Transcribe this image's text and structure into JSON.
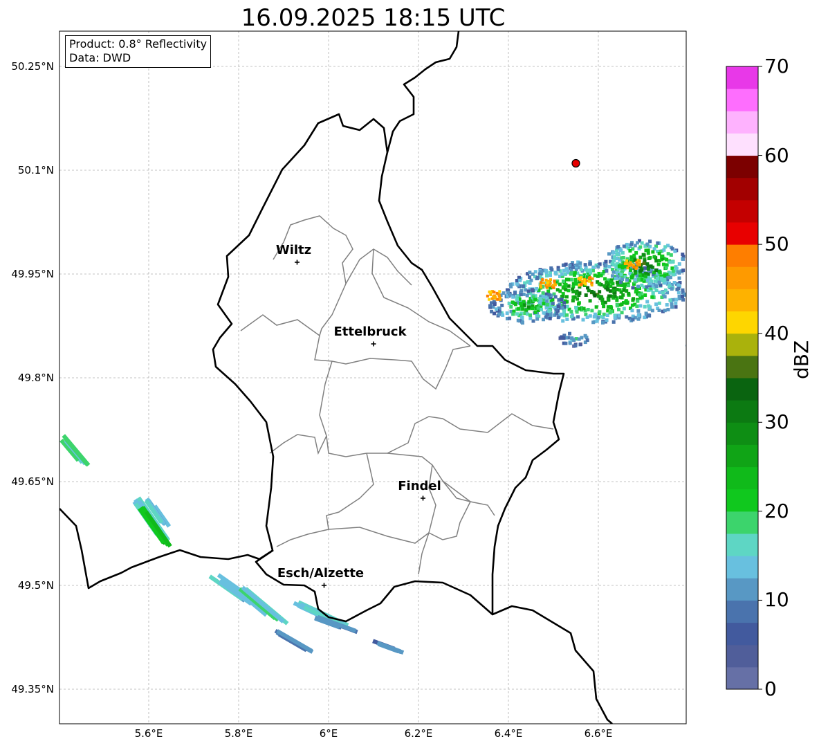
{
  "title": "16.09.2025 18:15 UTC",
  "info": {
    "product": "Product: 0.8° Reflectivity",
    "data": "Data: DWD"
  },
  "lat_ticks": [
    "50.25°N",
    "50.1°N",
    "49.95°N",
    "49.8°N",
    "49.65°N",
    "49.5°N",
    "49.35°N"
  ],
  "lon_ticks": [
    "5.6°E",
    "5.8°E",
    "6°E",
    "6.2°E",
    "6.4°E",
    "6.6°E"
  ],
  "cities": [
    {
      "name": "Wiltz",
      "lon": 5.93,
      "lat": 49.967
    },
    {
      "name": "Ettelbruck",
      "lon": 6.1,
      "lat": 49.849
    },
    {
      "name": "Findel",
      "lon": 6.21,
      "lat": 49.626
    },
    {
      "name": "Esch/Alzette",
      "lon": 5.99,
      "lat": 49.5
    }
  ],
  "marker": {
    "lon": 6.55,
    "lat": 50.11,
    "color": "#e60000"
  },
  "colorbar": {
    "label": "dBZ",
    "min": 0,
    "max": 70,
    "ticks": [
      "70",
      "60",
      "50",
      "40",
      "30",
      "20",
      "10",
      "0"
    ],
    "colors": [
      "#6670a6",
      "#505e9a",
      "#425a9e",
      "#4a73ad",
      "#5898c4",
      "#68c0df",
      "#5ed6c4",
      "#3cd46c",
      "#10c81e",
      "#10ba1a",
      "#10a416",
      "#0e8e14",
      "#0c7a12",
      "#0a6410",
      "#4a7412",
      "#aab20c",
      "#fed600",
      "#feb200",
      "#fe9a00",
      "#fe7e00",
      "#e80000",
      "#c40000",
      "#a20000",
      "#7c0000",
      "#fee0fe",
      "#feb2fe",
      "#fe6efe",
      "#e838e8"
    ]
  }
}
